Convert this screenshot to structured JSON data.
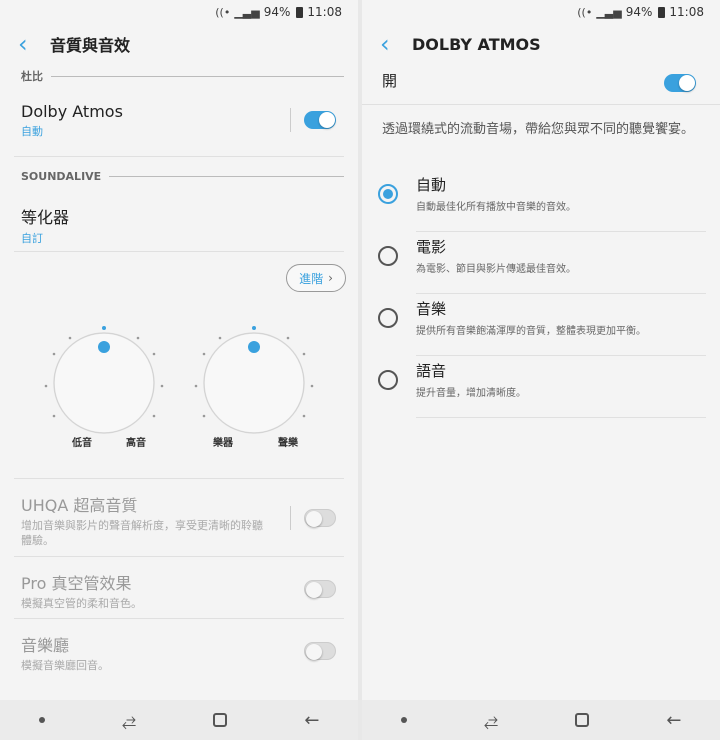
{
  "status": {
    "battery": "94%",
    "time": "11:08",
    "wifi_icon": "wifi-icon",
    "signal_icon": "signal-icon"
  },
  "colors": {
    "accent": "#3aa1de"
  },
  "left": {
    "title": "音質與音效",
    "dolby_section": "杜比",
    "dolby": {
      "title": "Dolby Atmos",
      "sub": "自動",
      "enabled": true
    },
    "soundalive_section": "SOUNDALIVE",
    "eq": {
      "title": "等化器",
      "sub": "自訂"
    },
    "advanced_label": "進階",
    "knob_labels": {
      "bass": "低音",
      "treble": "高音",
      "instrument": "樂器",
      "vocal": "聲樂"
    },
    "uhqa": {
      "title": "UHQA 超高音質",
      "sub": "增加音樂與影片的聲音解析度，享受更清晰的聆聽體驗。",
      "enabled": false
    },
    "tube": {
      "title": "Pro 真空管效果",
      "sub": "模擬真空管的柔和音色。",
      "enabled": false
    },
    "hall": {
      "title": "音樂廳",
      "sub": "模擬音樂廳回音。",
      "enabled": false
    }
  },
  "right": {
    "title": "DOLBY ATMOS",
    "open_label": "開",
    "open_enabled": true,
    "description": "透過環繞式的流動音場，帶給您與眾不同的聽覺饗宴。",
    "options": [
      {
        "title": "自動",
        "sub": "自動最佳化所有播放中音樂的音效。",
        "selected": true
      },
      {
        "title": "電影",
        "sub": "為電影、節目與影片傳遞最佳音效。",
        "selected": false
      },
      {
        "title": "音樂",
        "sub": "提供所有音樂飽滿渾厚的音質，整體表現更加平衡。",
        "selected": false
      },
      {
        "title": "語音",
        "sub": "提升音量，增加清晰度。",
        "selected": false
      }
    ]
  }
}
